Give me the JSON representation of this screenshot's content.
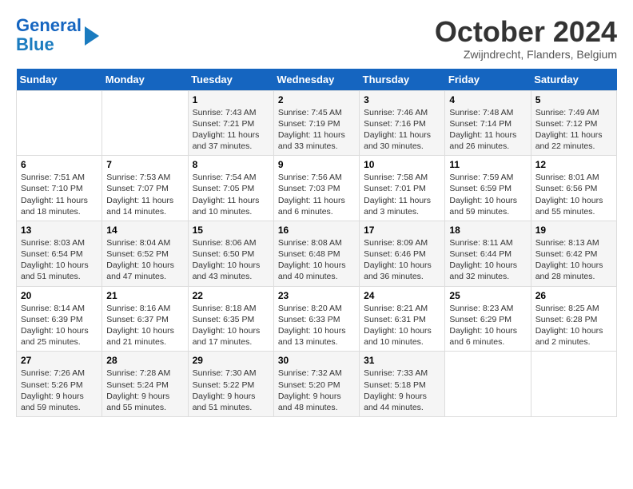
{
  "logo": {
    "line1": "General",
    "line2": "Blue"
  },
  "title": "October 2024",
  "subtitle": "Zwijndrecht, Flanders, Belgium",
  "headers": [
    "Sunday",
    "Monday",
    "Tuesday",
    "Wednesday",
    "Thursday",
    "Friday",
    "Saturday"
  ],
  "weeks": [
    [
      {
        "day": "",
        "info": ""
      },
      {
        "day": "",
        "info": ""
      },
      {
        "day": "1",
        "info": "Sunrise: 7:43 AM\nSunset: 7:21 PM\nDaylight: 11 hours\nand 37 minutes."
      },
      {
        "day": "2",
        "info": "Sunrise: 7:45 AM\nSunset: 7:19 PM\nDaylight: 11 hours\nand 33 minutes."
      },
      {
        "day": "3",
        "info": "Sunrise: 7:46 AM\nSunset: 7:16 PM\nDaylight: 11 hours\nand 30 minutes."
      },
      {
        "day": "4",
        "info": "Sunrise: 7:48 AM\nSunset: 7:14 PM\nDaylight: 11 hours\nand 26 minutes."
      },
      {
        "day": "5",
        "info": "Sunrise: 7:49 AM\nSunset: 7:12 PM\nDaylight: 11 hours\nand 22 minutes."
      }
    ],
    [
      {
        "day": "6",
        "info": "Sunrise: 7:51 AM\nSunset: 7:10 PM\nDaylight: 11 hours\nand 18 minutes."
      },
      {
        "day": "7",
        "info": "Sunrise: 7:53 AM\nSunset: 7:07 PM\nDaylight: 11 hours\nand 14 minutes."
      },
      {
        "day": "8",
        "info": "Sunrise: 7:54 AM\nSunset: 7:05 PM\nDaylight: 11 hours\nand 10 minutes."
      },
      {
        "day": "9",
        "info": "Sunrise: 7:56 AM\nSunset: 7:03 PM\nDaylight: 11 hours\nand 6 minutes."
      },
      {
        "day": "10",
        "info": "Sunrise: 7:58 AM\nSunset: 7:01 PM\nDaylight: 11 hours\nand 3 minutes."
      },
      {
        "day": "11",
        "info": "Sunrise: 7:59 AM\nSunset: 6:59 PM\nDaylight: 10 hours\nand 59 minutes."
      },
      {
        "day": "12",
        "info": "Sunrise: 8:01 AM\nSunset: 6:56 PM\nDaylight: 10 hours\nand 55 minutes."
      }
    ],
    [
      {
        "day": "13",
        "info": "Sunrise: 8:03 AM\nSunset: 6:54 PM\nDaylight: 10 hours\nand 51 minutes."
      },
      {
        "day": "14",
        "info": "Sunrise: 8:04 AM\nSunset: 6:52 PM\nDaylight: 10 hours\nand 47 minutes."
      },
      {
        "day": "15",
        "info": "Sunrise: 8:06 AM\nSunset: 6:50 PM\nDaylight: 10 hours\nand 43 minutes."
      },
      {
        "day": "16",
        "info": "Sunrise: 8:08 AM\nSunset: 6:48 PM\nDaylight: 10 hours\nand 40 minutes."
      },
      {
        "day": "17",
        "info": "Sunrise: 8:09 AM\nSunset: 6:46 PM\nDaylight: 10 hours\nand 36 minutes."
      },
      {
        "day": "18",
        "info": "Sunrise: 8:11 AM\nSunset: 6:44 PM\nDaylight: 10 hours\nand 32 minutes."
      },
      {
        "day": "19",
        "info": "Sunrise: 8:13 AM\nSunset: 6:42 PM\nDaylight: 10 hours\nand 28 minutes."
      }
    ],
    [
      {
        "day": "20",
        "info": "Sunrise: 8:14 AM\nSunset: 6:39 PM\nDaylight: 10 hours\nand 25 minutes."
      },
      {
        "day": "21",
        "info": "Sunrise: 8:16 AM\nSunset: 6:37 PM\nDaylight: 10 hours\nand 21 minutes."
      },
      {
        "day": "22",
        "info": "Sunrise: 8:18 AM\nSunset: 6:35 PM\nDaylight: 10 hours\nand 17 minutes."
      },
      {
        "day": "23",
        "info": "Sunrise: 8:20 AM\nSunset: 6:33 PM\nDaylight: 10 hours\nand 13 minutes."
      },
      {
        "day": "24",
        "info": "Sunrise: 8:21 AM\nSunset: 6:31 PM\nDaylight: 10 hours\nand 10 minutes."
      },
      {
        "day": "25",
        "info": "Sunrise: 8:23 AM\nSunset: 6:29 PM\nDaylight: 10 hours\nand 6 minutes."
      },
      {
        "day": "26",
        "info": "Sunrise: 8:25 AM\nSunset: 6:28 PM\nDaylight: 10 hours\nand 2 minutes."
      }
    ],
    [
      {
        "day": "27",
        "info": "Sunrise: 7:26 AM\nSunset: 5:26 PM\nDaylight: 9 hours\nand 59 minutes."
      },
      {
        "day": "28",
        "info": "Sunrise: 7:28 AM\nSunset: 5:24 PM\nDaylight: 9 hours\nand 55 minutes."
      },
      {
        "day": "29",
        "info": "Sunrise: 7:30 AM\nSunset: 5:22 PM\nDaylight: 9 hours\nand 51 minutes."
      },
      {
        "day": "30",
        "info": "Sunrise: 7:32 AM\nSunset: 5:20 PM\nDaylight: 9 hours\nand 48 minutes."
      },
      {
        "day": "31",
        "info": "Sunrise: 7:33 AM\nSunset: 5:18 PM\nDaylight: 9 hours\nand 44 minutes."
      },
      {
        "day": "",
        "info": ""
      },
      {
        "day": "",
        "info": ""
      }
    ]
  ]
}
